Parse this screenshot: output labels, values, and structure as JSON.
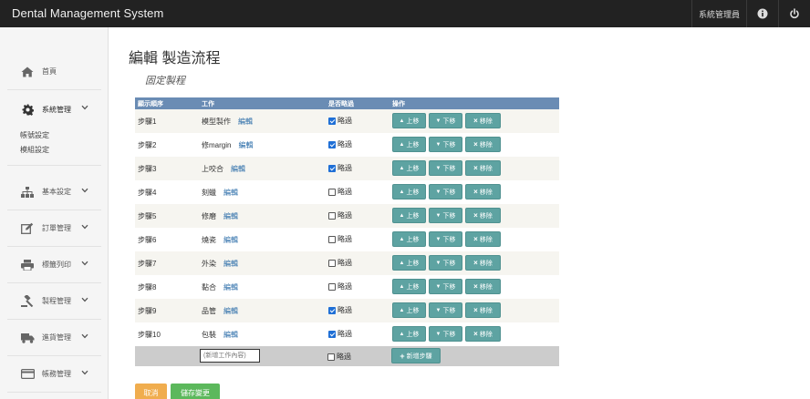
{
  "app": {
    "title": "Dental Management System",
    "user": "系統管理員"
  },
  "sidebar": {
    "home": "首頁",
    "system": "系統管理",
    "system_sub": [
      "帳號設定",
      "模組設定"
    ],
    "basic": "基本設定",
    "orders": "訂單管理",
    "labels": "標籤列印",
    "process": "製程管理",
    "shipping": "進貨管理",
    "accounts": "帳務管理"
  },
  "page": {
    "title": "編輯 製造流程",
    "subtitle": "固定製程"
  },
  "table": {
    "headers": {
      "order": "顯示順序",
      "work": "工作",
      "skip": "是否略過",
      "ops": "操作"
    },
    "edit_label": "編輯",
    "skip_label": "略過",
    "up_label": "上移",
    "down_label": "下移",
    "delete_label": "移除",
    "rows": [
      {
        "order": "步驟1",
        "work": "模型製作",
        "skip": true
      },
      {
        "order": "步驟2",
        "work": "修margin",
        "skip": true
      },
      {
        "order": "步驟3",
        "work": "上咬合",
        "skip": true
      },
      {
        "order": "步驟4",
        "work": "刻蠟",
        "skip": false
      },
      {
        "order": "步驟5",
        "work": "修磨",
        "skip": false
      },
      {
        "order": "步驟6",
        "work": "燒瓷",
        "skip": false
      },
      {
        "order": "步驟7",
        "work": "外染",
        "skip": false
      },
      {
        "order": "步驟8",
        "work": "黏合",
        "skip": false
      },
      {
        "order": "步驟9",
        "work": "品管",
        "skip": true
      },
      {
        "order": "步驟10",
        "work": "包裝",
        "skip": true
      }
    ],
    "new_placeholder": "(新增工作內容)",
    "add_step_label": "新增步驟"
  },
  "actions": {
    "cancel": "取消",
    "save": "儲存變更"
  },
  "colors": {
    "header": "#6a8cb4",
    "op_button": "#5ea3a2",
    "cancel": "#f0ad4e",
    "save": "#5cb85c"
  }
}
